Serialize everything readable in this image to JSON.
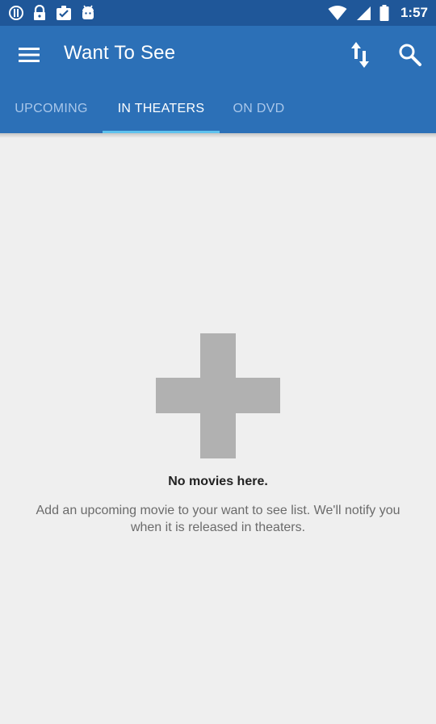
{
  "status_bar": {
    "time": "1:57",
    "icons_left": [
      "alert-circle-icon",
      "lock-icon",
      "clipboard-check-icon",
      "android-icon"
    ],
    "icons_right": [
      "wifi-icon",
      "signal-icon",
      "battery-icon"
    ]
  },
  "app_bar": {
    "title": "Want To See",
    "icons": [
      "menu-icon",
      "sort-icon",
      "search-icon"
    ],
    "tabs": [
      {
        "label": "UPCOMING",
        "active": false
      },
      {
        "label": "IN THEATERS",
        "active": true
      },
      {
        "label": "ON DVD",
        "active": false
      }
    ]
  },
  "empty_state": {
    "icon": "plus-icon",
    "title": "No movies here.",
    "description": "Add an upcoming movie to your want to see list. We'll notify you when it is released in theaters."
  },
  "colors": {
    "status_bar": "#1f5799",
    "app_bar": "#2c70b7",
    "tab_indicator": "#5fc2ee",
    "background": "#efefef",
    "plus_icon": "#b1b1b1"
  }
}
